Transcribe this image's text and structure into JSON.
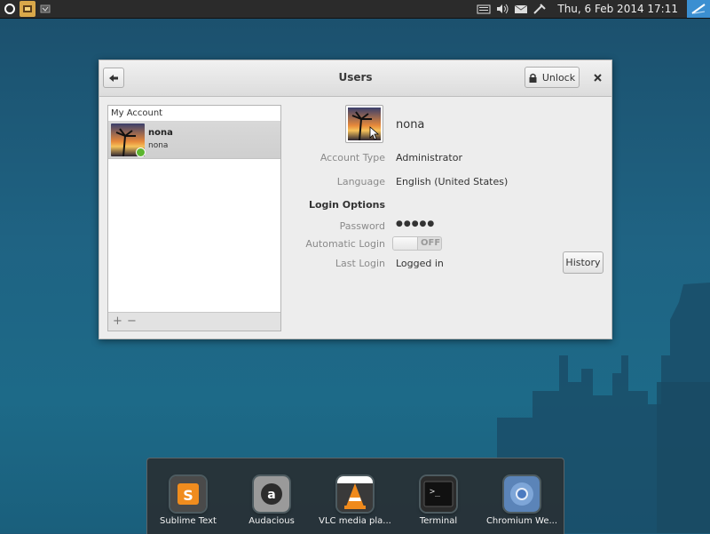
{
  "panel": {
    "clock": "Thu,  6 Feb 2014 17:11"
  },
  "window": {
    "title": "Users",
    "unlock_label": "Unlock"
  },
  "user_list": {
    "header": "My Account",
    "users": [
      {
        "name": "nona",
        "username": "nona",
        "status": "online"
      }
    ],
    "add_label": "+",
    "remove_label": "−"
  },
  "details": {
    "name": "nona",
    "account_type_label": "Account Type",
    "account_type": "Administrator",
    "language_label": "Language",
    "language": "English (United States)",
    "login_options": "Login Options",
    "password_label": "Password",
    "password": "●●●●●",
    "auto_login_label": "Automatic Login",
    "auto_login_state": "OFF",
    "last_login_label": "Last Login",
    "last_login": "Logged in",
    "history_label": "History"
  },
  "dock": {
    "items": [
      {
        "label": "Sublime Text",
        "icon": "sublime-text-icon"
      },
      {
        "label": "Audacious",
        "icon": "audacious-icon"
      },
      {
        "label": "VLC media pla...",
        "icon": "vlc-icon"
      },
      {
        "label": "Terminal",
        "icon": "terminal-icon"
      },
      {
        "label": "Chromium We...",
        "icon": "chromium-icon"
      }
    ]
  },
  "colors": {
    "desktop": "#1d5a78",
    "panel": "#2b2b2b",
    "online": "#5cb52f"
  }
}
